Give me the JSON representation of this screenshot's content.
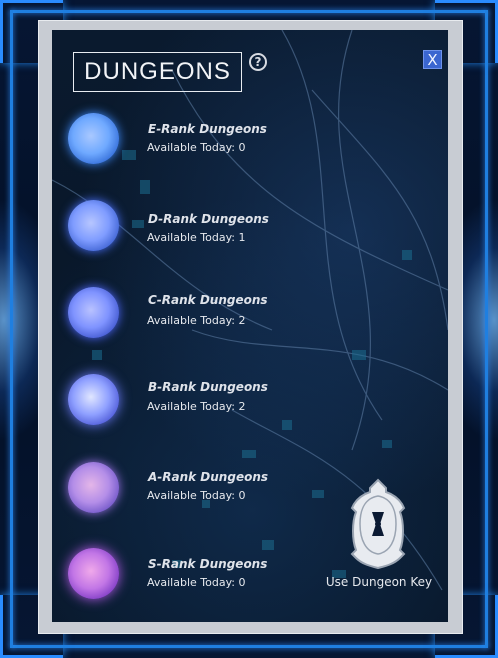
{
  "window": {
    "title": "DUNGEONS",
    "help_glyph": "?",
    "close_glyph": "X"
  },
  "dungeons": [
    {
      "rank": "E-Rank Dungeons",
      "available": "Available Today: 0",
      "orb_color": "#6fa9ff"
    },
    {
      "rank": "D-Rank Dungeons",
      "available": "Available Today: 1",
      "orb_color": "#7f9cff"
    },
    {
      "rank": "C-Rank Dungeons",
      "available": "Available Today: 2",
      "orb_color": "#7f93ff"
    },
    {
      "rank": "B-Rank Dungeons",
      "available": "Available Today: 2",
      "orb_color": "#8fa0ff"
    },
    {
      "rank": "A-Rank Dungeons",
      "available": "Available Today: 0",
      "orb_color": "#b48ee8"
    },
    {
      "rank": "S-Rank Dungeons",
      "available": "Available Today: 0",
      "orb_color": "#c276e6"
    }
  ],
  "key": {
    "label": "Use Dungeon Key",
    "icon": "dungeon-key-icon"
  },
  "colors": {
    "hud_blue": "#1f7fe0",
    "frame_gray": "#c8ccd3",
    "panel_dark": "#0a1a2e",
    "close_blue": "#3b66d0"
  }
}
